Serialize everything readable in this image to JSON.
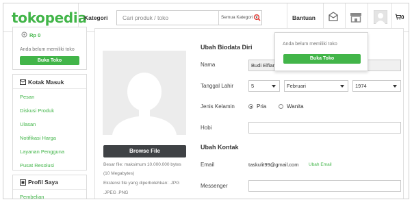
{
  "header": {
    "logo": "tokopedia",
    "kategori": "Kategori",
    "search_placeholder": "Cari produk / toko",
    "search_category": "Semua Kategori",
    "bantuan": "Bantuan",
    "cart_count": "0",
    "accent_color": "#42b549"
  },
  "shop_popup": {
    "note": "Anda belum memiliki toko",
    "button": "Buka Toko"
  },
  "sidebar": {
    "balance": "Rp 0",
    "no_shop_note": "Anda belum memiliki toko",
    "open_shop_button": "Buka Toko",
    "inbox_heading": "Kotak Masuk",
    "inbox_items": [
      "Pesan",
      "Diskusi Produk",
      "Ulasan",
      "Notifikasi Harga",
      "Layanan Pengguna",
      "Pusat Resolusi"
    ],
    "profile_heading": "Profil Saya",
    "profile_items": [
      "Pembelian"
    ]
  },
  "photo": {
    "browse_button": "Browse File",
    "notes": [
      "Besar file: maksimum 10.000.000 bytes",
      "(10 Megabytes)",
      "Ekstensi file yang diperbolehkan: .JPG",
      ".JPEG .PNG"
    ]
  },
  "biodata": {
    "title": "Ubah Biodata Diri",
    "name_label": "Nama",
    "name_value": "Budi Elfian",
    "birth_label": "Tanggal Lahir",
    "birth_day": "5",
    "birth_month": "Februari",
    "birth_year": "1974",
    "gender_label": "Jenis Kelamin",
    "gender_options": [
      "Pria",
      "Wanita"
    ],
    "gender_selected": "Pria",
    "hobby_label": "Hobi",
    "hobby_value": ""
  },
  "contact": {
    "title": "Ubah Kontak",
    "email_label": "Email",
    "email_value": "taskulit99@gmail.com",
    "email_change_link": "Ubah Email",
    "messenger_label": "Messenger",
    "messenger_value": ""
  }
}
